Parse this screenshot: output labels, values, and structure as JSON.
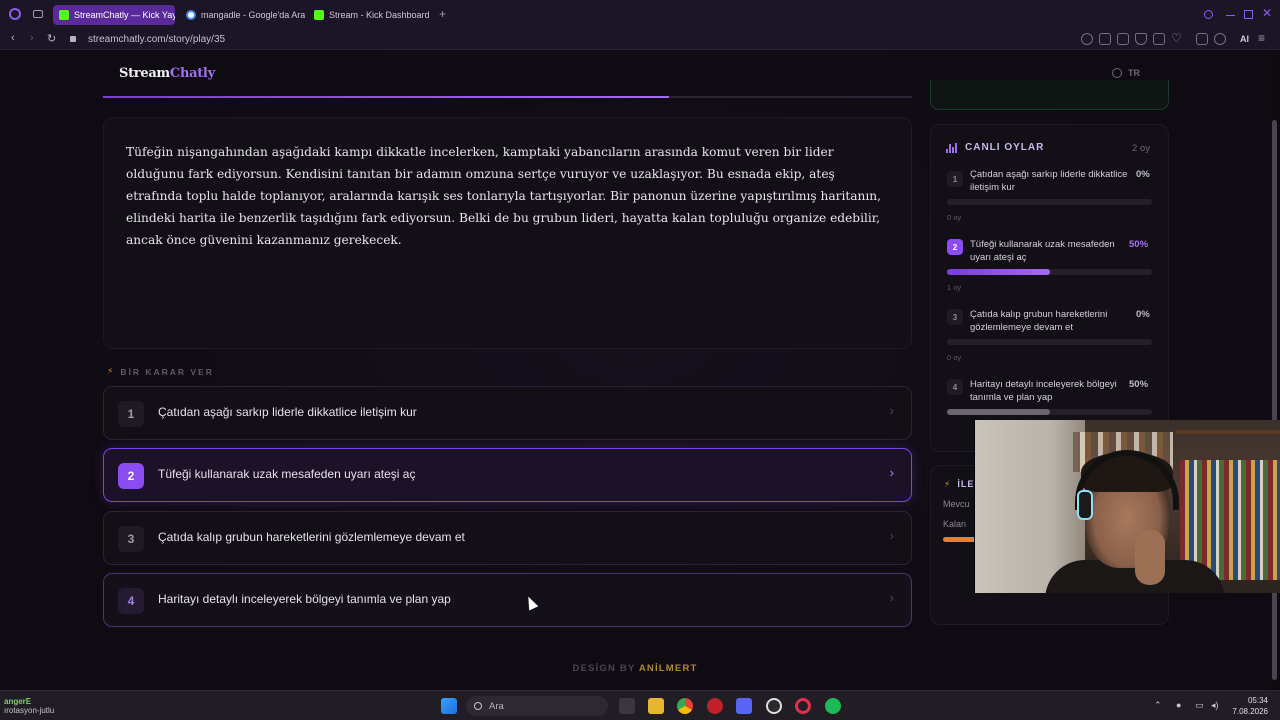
{
  "browser": {
    "tabs": [
      {
        "label": "StreamChatly — Kick Yayın",
        "active": true,
        "favicon_color": "#53fc18"
      },
      {
        "label": "mangadle - Google'da Ara",
        "active": false,
        "favicon_color": "#4285f4"
      },
      {
        "label": "Stream - Kick Dashboard",
        "active": false,
        "favicon_color": "#53fc18"
      }
    ],
    "new_tab": "+",
    "url": "streamchatly.com/story/play/35",
    "ai_label": "AI"
  },
  "page": {
    "logo_stream": "Stream",
    "logo_chatly": "Chatly",
    "lang": "TR",
    "progress_fraction": 0.7,
    "story_text": "Tüfeğin nişangahından aşağıdaki kampı dikkatle incelerken, kamptaki yabancıların arasında komut veren bir lider olduğunu fark ediyorsun. Kendisini tanıtan bir adamın omzuna sertçe vuruyor ve uzaklaşıyor. Bu esnada ekip, ateş etrafında toplu halde toplanıyor, aralarında karışık ses tonlarıyla tartışıyorlar. Bir panonun üzerine yapıştırılmış haritanın, elindeki harita ile benzerlik taşıdığını fark ediyorsun. Belki de bu grubun lideri, hayatta kalan topluluğu organize edebilir, ancak önce güvenini kazanmanız gerekecek.",
    "decide_label": "BİR KARAR VER",
    "choices": [
      {
        "num": "1",
        "text": "Çatıdan aşağı sarkıp liderle dikkatlice iletişim kur"
      },
      {
        "num": "2",
        "text": "Tüfeği kullanarak uzak mesafeden uyarı ateşi aç"
      },
      {
        "num": "3",
        "text": "Çatıda kalıp grubun hareketlerini gözlemlemeye devam et"
      },
      {
        "num": "4",
        "text": "Haritayı detaylı inceleyerek bölgeyi tanımla ve plan yap"
      }
    ],
    "chevron": "›",
    "footer_prefix": "DESİGN BY",
    "footer_author": "ANİLMERT"
  },
  "votes": {
    "title": "CANLI OYLAR",
    "total": "2 oy",
    "items": [
      {
        "num": "1",
        "text": "Çatıdan aşağı sarkıp liderle dikkatlice iletişim kur",
        "pct": "0%",
        "count": "0 oy",
        "fraction": 0
      },
      {
        "num": "2",
        "text": "Tüfeği kullanarak uzak mesafeden uyarı ateşi aç",
        "pct": "50%",
        "count": "1 oy",
        "fraction": 0.5
      },
      {
        "num": "3",
        "text": "Çatıda kalıp grubun hareketlerini gözlemlemeye devam et",
        "pct": "0%",
        "count": "0 oy",
        "fraction": 0
      },
      {
        "num": "4",
        "text": "Haritayı detaylı inceleyerek bölgeyi tanımla ve plan yap",
        "pct": "50%",
        "count": "",
        "fraction": 0.5
      }
    ]
  },
  "next": {
    "title": "İLE",
    "current": "Mevcu",
    "remaining": "Kalan"
  },
  "taskbar": {
    "user": "angerE",
    "status": "ırotasyon-jutlu",
    "search_placeholder": "Ara",
    "time": "05:34",
    "date": "7.08.2026"
  }
}
